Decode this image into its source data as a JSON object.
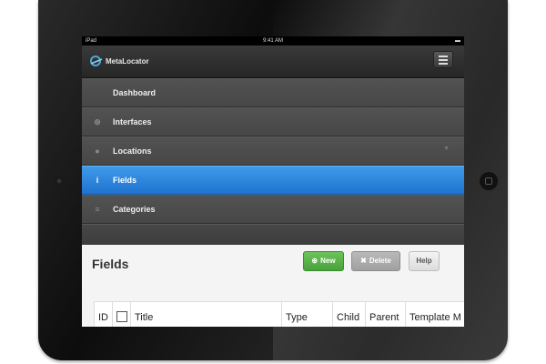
{
  "status_bar": {
    "device": "iPad",
    "time": "9:41 AM",
    "battery": "▬"
  },
  "app": {
    "logo_text": "MetaLocator"
  },
  "nav": {
    "items": [
      {
        "label": "Dashboard",
        "icon": "none"
      },
      {
        "label": "Interfaces",
        "icon": "globe-icon"
      },
      {
        "label": "Locations",
        "icon": "map-pin-icon"
      },
      {
        "label": "Fields",
        "icon": "info-icon",
        "active": true
      },
      {
        "label": "Categories",
        "icon": "stack-icon"
      }
    ]
  },
  "page": {
    "title": "Fields",
    "buttons": {
      "new": "New",
      "delete": "Delete",
      "help": "Help"
    }
  },
  "table": {
    "columns": [
      "ID",
      "Title",
      "Type",
      "Child",
      "Parent",
      "Template M"
    ]
  },
  "colors": {
    "active_nav": "#2a84dc",
    "new_button": "#5ab34a"
  }
}
